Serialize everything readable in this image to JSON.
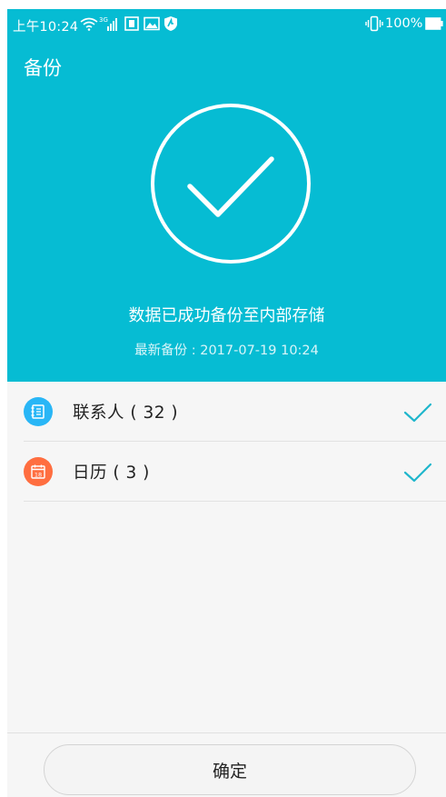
{
  "status_bar": {
    "time": "上午10:24",
    "signal_tag": "3G",
    "battery": "100%",
    "icons": [
      "wifi-icon",
      "signal-icon",
      "sim-icon",
      "image-icon",
      "shield-icon",
      "vibrate-icon",
      "battery-icon"
    ]
  },
  "header": {
    "title": "备份"
  },
  "result": {
    "message": "数据已成功备份至内部存储",
    "latest_backup": "最新备份 : 2017-07-19 10:24"
  },
  "items": [
    {
      "label": "联系人 ( 32 )",
      "icon": "contacts-icon",
      "icon_color": "#29b6f6",
      "checked": true
    },
    {
      "label": "日历 ( 3 )",
      "icon": "calendar-icon",
      "icon_color": "#ff6e40",
      "calendar_day": "18",
      "checked": true
    }
  ],
  "footer": {
    "confirm_label": "确定"
  },
  "colors": {
    "accent": "#06bcd3",
    "check": "#1fb6cc",
    "background": "#f6f6f6"
  }
}
